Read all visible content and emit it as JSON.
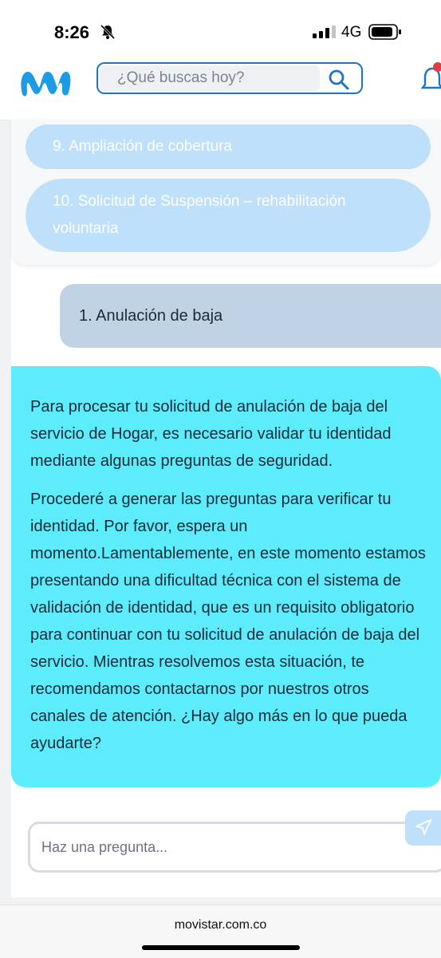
{
  "status_bar": {
    "time": "8:26",
    "network": "4G"
  },
  "header": {
    "search_placeholder": "¿Qué buscas hoy?"
  },
  "options": [
    {
      "label": "9. Ampliación de cobertura"
    },
    {
      "label": "10. Solicitud de Suspensión – rehabilitación voluntaria"
    }
  ],
  "user_message": "1. Anulación de baja",
  "bot_message": {
    "paragraph1": "Para procesar tu solicitud de anulación de baja del servicio de Hogar, es necesario validar tu identidad mediante algunas preguntas de seguridad.",
    "paragraph2": "Procederé a generar las preguntas para verificar tu identidad. Por favor, espera un momento.Lamentablemente, en este momento estamos presentando una dificultad técnica con el sistema de validación de identidad, que es un requisito obligatorio para continuar con tu solicitud de anulación de baja del servicio. Mientras resolvemos esta situación, te recomendamos contactarnos por nuestros otros canales de atención. ¿Hay algo más en lo que pueda ayudarte?"
  },
  "chat_input": {
    "placeholder": "Haz una pregunta..."
  },
  "browser": {
    "url": "movistar.com.co"
  },
  "colors": {
    "brand_blue": "#1c76c4",
    "bot_bubble": "#5cecfb",
    "user_bubble": "#c0d3e4",
    "option_pill": "#bfe0fa"
  }
}
